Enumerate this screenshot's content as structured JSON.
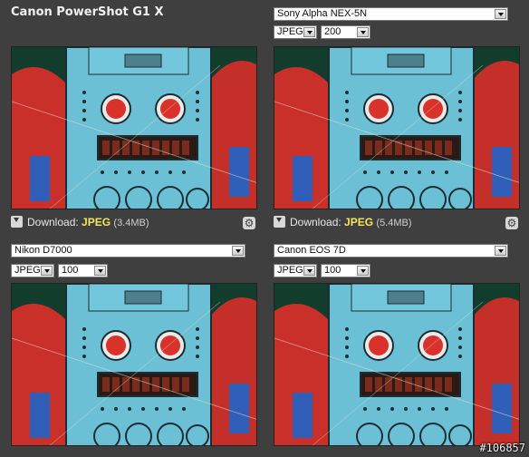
{
  "panels": [
    {
      "title": "Canon PowerShot G1 X",
      "camera": null,
      "format": null,
      "quality": null,
      "download_label": "Download:",
      "download_format": "JPEG",
      "download_size": "(3.4MB)"
    },
    {
      "title": null,
      "camera": "Sony Alpha NEX-5N",
      "format": "JPEG",
      "quality": "200",
      "download_label": "Download:",
      "download_format": "JPEG",
      "download_size": "(5.4MB)"
    },
    {
      "title": null,
      "camera": "Nikon D7000",
      "format": "JPEG",
      "quality": "100",
      "download_label": null,
      "download_format": null,
      "download_size": null
    },
    {
      "title": null,
      "camera": "Canon EOS 7D",
      "format": "JPEG",
      "quality": "100",
      "download_label": null,
      "download_format": null,
      "download_size": null
    }
  ],
  "watermark": "#106857",
  "colors": {
    "background": "#3f3f3f",
    "download_format": "#f5e65a"
  }
}
